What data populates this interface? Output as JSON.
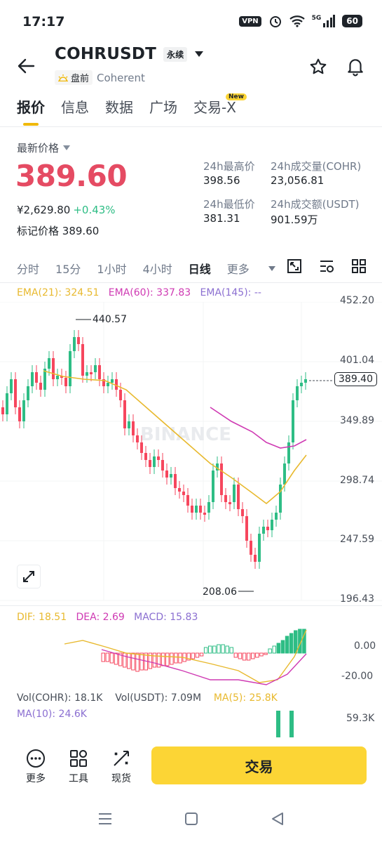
{
  "status_bar": {
    "time": "17:17",
    "vpn": "VPN",
    "network": "5G",
    "battery": "60"
  },
  "header": {
    "symbol": "COHRUSDT",
    "contract_type": "永续",
    "session": "盘前",
    "company": "Coherent"
  },
  "tabs": [
    {
      "label": "报价",
      "active": true
    },
    {
      "label": "信息"
    },
    {
      "label": "数据"
    },
    {
      "label": "广场"
    },
    {
      "label": "交易-X",
      "badge": "New"
    }
  ],
  "quote": {
    "last_price_label": "最新价格",
    "last_price": "389.60",
    "cny_price": "¥2,629.80",
    "change_pct": "+0.43%",
    "mark_price_label": "标记价格",
    "mark_price": "389.60",
    "high_label": "24h最高价",
    "high": "398.56",
    "low_label": "24h最低价",
    "low": "381.31",
    "vol_label": "24h成交量(COHR)",
    "vol": "23,056.81",
    "amount_label": "24h成交额(USDT)",
    "amount": "901.59万"
  },
  "intervals": [
    "分时",
    "15分",
    "1小时",
    "4小时",
    "日线",
    "更多"
  ],
  "active_interval": "日线",
  "chart": {
    "ema21": "EMA(21): 324.51",
    "ema60": "EMA(60): 337.83",
    "ema145": "EMA(145): --",
    "price_axis": [
      "452.20",
      "401.04",
      "349.89",
      "298.74",
      "247.59",
      "196.43"
    ],
    "current_price_tag": "389.40",
    "high_marker": "440.57",
    "low_marker": "208.06",
    "watermark": "BINANCE",
    "colors": {
      "up": "#2ebd85",
      "down": "#f6465d",
      "ema21": "#e8b92e",
      "ema60": "#cf3ab3",
      "ema145": "#8b6fd1"
    }
  },
  "macd": {
    "dif": "DIF: 18.51",
    "dea": "DEA: 2.69",
    "macd": "MACD: 15.83",
    "axis": [
      "0.00",
      "-20.00"
    ]
  },
  "volume": {
    "vol_base": "Vol(COHR): 18.1K",
    "vol_quote": "Vol(USDT): 7.09M",
    "ma5": "MA(5): 25.8K",
    "ma10": "MA(10): 24.6K",
    "axis": "59.3K"
  },
  "bottom_bar": {
    "more": "更多",
    "tools": "工具",
    "spot": "现货",
    "trade": "交易"
  },
  "chart_data": {
    "type": "candlestick",
    "ylim": [
      196.43,
      452.2
    ],
    "series": [
      {
        "name": "EMA(21)"
      },
      {
        "name": "EMA(60)"
      },
      {
        "name": "EMA(145)"
      }
    ],
    "high": 440.57,
    "low": 208.06,
    "last": 389.4
  }
}
